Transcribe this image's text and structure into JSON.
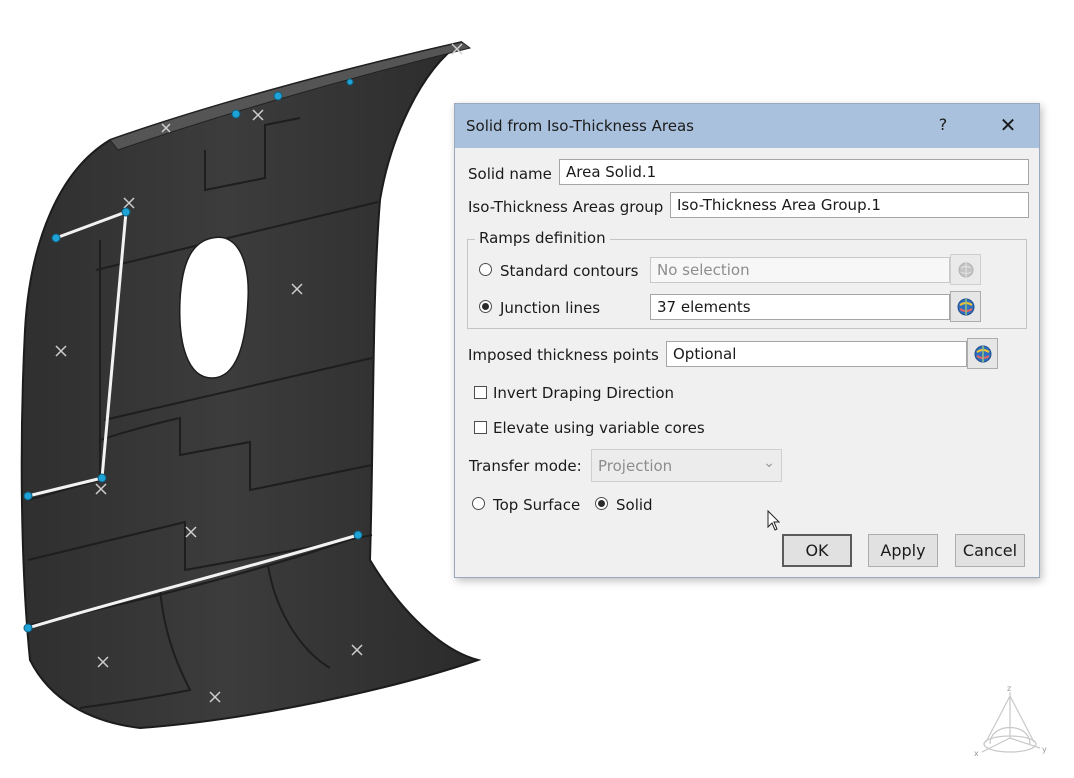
{
  "dialog": {
    "title": "Solid from Iso-Thickness Areas",
    "help_label": "?",
    "close_label": "✕",
    "solid_name_label": "Solid name",
    "solid_name_value": "Area Solid.1",
    "group_label": "Iso-Thickness Areas group",
    "group_value": "Iso-Thickness Area Group.1",
    "ramps": {
      "legend": "Ramps definition",
      "standard_contours_label": "Standard contours",
      "standard_contours_value": "No selection",
      "standard_contours_selected": false,
      "junction_lines_label": "Junction lines",
      "junction_lines_value": "37 elements",
      "junction_lines_selected": true
    },
    "imposed_label": "Imposed thickness points",
    "imposed_value": "Optional",
    "invert_label": "Invert Draping Direction",
    "invert_checked": false,
    "elevate_label": "Elevate using variable cores",
    "elevate_checked": false,
    "transfer_label": "Transfer mode:",
    "transfer_value": "Projection",
    "top_surface_label": "Top Surface",
    "top_surface_selected": false,
    "solid_label": "Solid",
    "solid_selected": true,
    "ok_label": "OK",
    "apply_label": "Apply",
    "cancel_label": "Cancel"
  },
  "axis": {
    "z_label": "z",
    "x_label": "x",
    "y_label": "y"
  },
  "colors": {
    "titlebar": "#a9c1dc",
    "dialog_bg": "#f0f0f0",
    "surface": "#3a3a3a",
    "junction_point": "#1fa3d6"
  },
  "icons": [
    "help-icon",
    "close-icon",
    "selection-globe-icon",
    "chevron-down-icon",
    "mouse-cursor-icon",
    "axis-compass-icon"
  ]
}
